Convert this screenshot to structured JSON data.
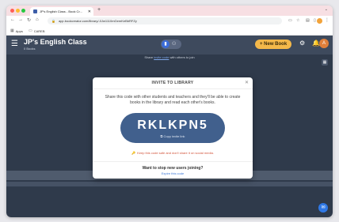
{
  "browser": {
    "tab_title": "JP's English Class - Book Cr...",
    "tab_close": "✕",
    "new_tab": "+",
    "tab_menu": "⌄",
    "url": "app.bookcreator.com/library/-0Jw1110mGemKeBbRFZy",
    "bookmarks": [
      {
        "label": "Apps",
        "icon": "grid-icon"
      },
      {
        "label": "CAREB",
        "icon": "folder-icon"
      }
    ]
  },
  "header": {
    "class_name": "JP's English Class",
    "books_label": "0 Books",
    "new_book_label": "+ New Book",
    "avatar_initial": "A"
  },
  "banner": {
    "prefix": "Share ",
    "link": "invite code",
    "suffix": " with others to join"
  },
  "modal": {
    "title": "INVITE TO LIBRARY",
    "description": "Share this code with other students and teachers and they'll be able to create books in the library and read each other's books.",
    "code": "RKLKPN5",
    "copy_label": "Copy invite link",
    "warning": "Keep this code safe and don't share it on social media.",
    "stop_question": "Want to stop new users joining?",
    "expire_label": "Expire this code"
  },
  "colors": {
    "accent": "#f4b84a",
    "code_bg": "#41608d",
    "warning": "#d2533a",
    "app_bg": "#2f3a4b"
  }
}
